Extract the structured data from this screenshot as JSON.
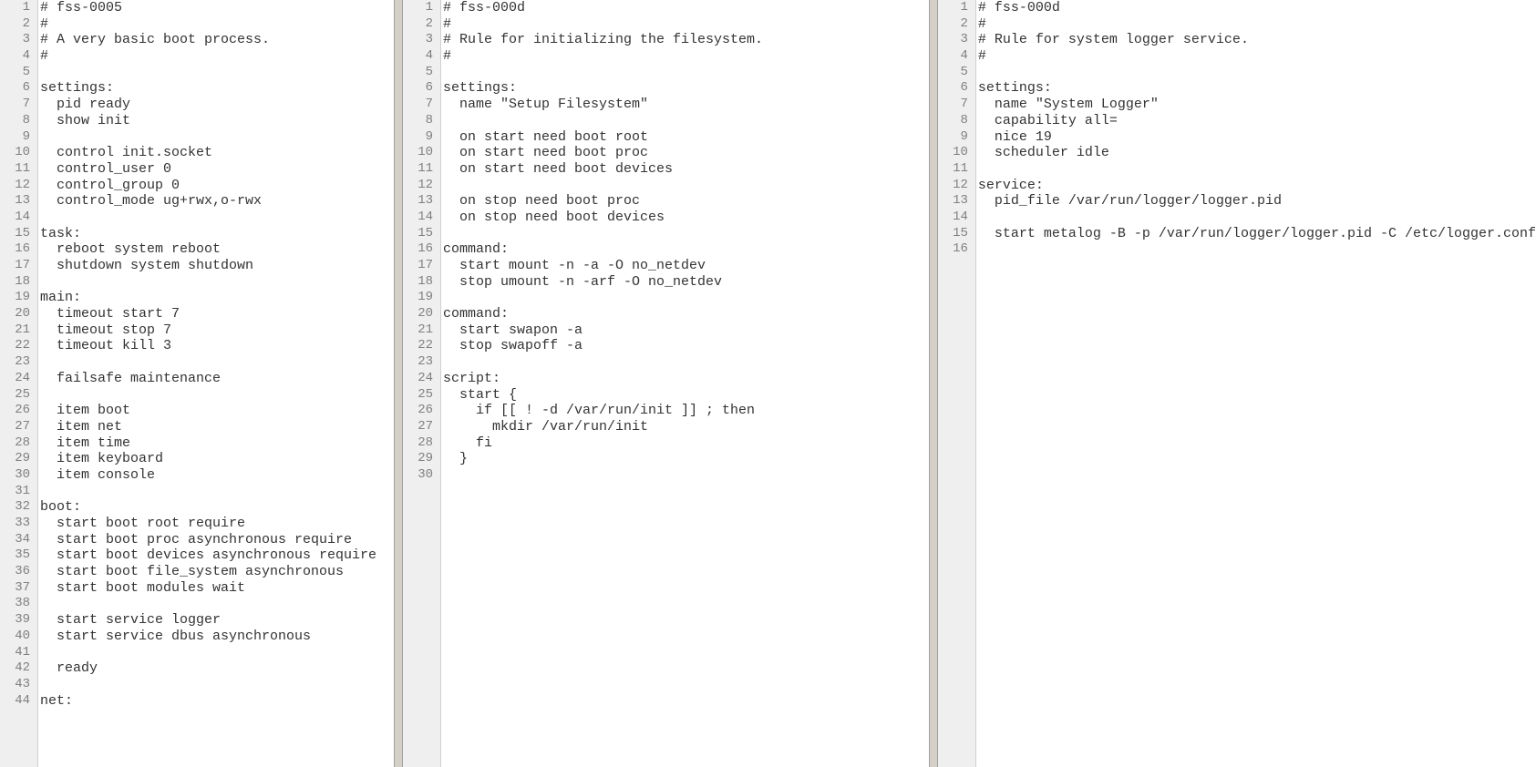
{
  "panes": [
    {
      "name": "pane-left",
      "start_line": 1,
      "lines": [
        "# fss-0005",
        "#",
        "# A very basic boot process.",
        "#",
        "",
        "settings:",
        "  pid ready",
        "  show init",
        "",
        "  control init.socket",
        "  control_user 0",
        "  control_group 0",
        "  control_mode ug+rwx,o-rwx",
        "",
        "task:",
        "  reboot system reboot",
        "  shutdown system shutdown",
        "",
        "main:",
        "  timeout start 7",
        "  timeout stop 7",
        "  timeout kill 3",
        "",
        "  failsafe maintenance",
        "",
        "  item boot",
        "  item net",
        "  item time",
        "  item keyboard",
        "  item console",
        "",
        "boot:",
        "  start boot root require",
        "  start boot proc asynchronous require",
        "  start boot devices asynchronous require",
        "  start boot file_system asynchronous",
        "  start boot modules wait",
        "",
        "  start service logger",
        "  start service dbus asynchronous",
        "",
        "  ready",
        "",
        "net:"
      ]
    },
    {
      "name": "pane-middle",
      "start_line": 1,
      "lines": [
        "# fss-000d",
        "#",
        "# Rule for initializing the filesystem.",
        "#",
        "",
        "settings:",
        "  name \"Setup Filesystem\"",
        "",
        "  on start need boot root",
        "  on start need boot proc",
        "  on start need boot devices",
        "",
        "  on stop need boot proc",
        "  on stop need boot devices",
        "",
        "command:",
        "  start mount -n -a -O no_netdev",
        "  stop umount -n -arf -O no_netdev",
        "",
        "command:",
        "  start swapon -a",
        "  stop swapoff -a",
        "",
        "script:",
        "  start {",
        "    if [[ ! -d /var/run/init ]] ; then",
        "      mkdir /var/run/init",
        "    fi",
        "  }",
        ""
      ]
    },
    {
      "name": "pane-right",
      "start_line": 1,
      "lines": [
        "# fss-000d",
        "#",
        "# Rule for system logger service.",
        "#",
        "",
        "settings:",
        "  name \"System Logger\"",
        "  capability all=",
        "  nice 19",
        "  scheduler idle",
        "",
        "service:",
        "  pid_file /var/run/logger/logger.pid",
        "",
        "  start metalog -B -p /var/run/logger/logger.pid -C /etc/logger.conf",
        ""
      ]
    }
  ]
}
